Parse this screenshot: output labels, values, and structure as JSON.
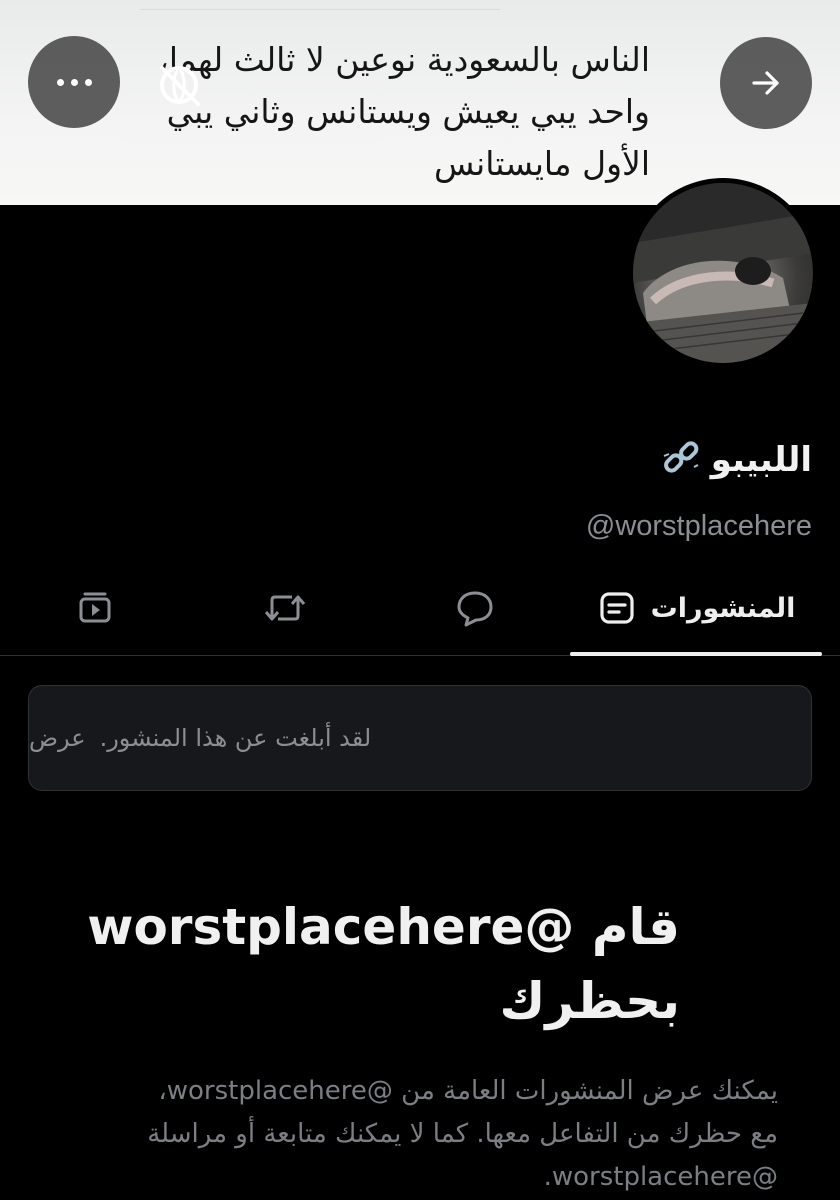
{
  "banner": {
    "text_lines": [
      "الناس بالسعودية نوعين لا ثالث لهما،",
      "واحد يبي يعيش ويستانس وثاني يبي",
      "الأول مايستانس"
    ],
    "more_icon": "more-horizontal-icon",
    "next_icon": "arrow-right-icon",
    "translate_icon": "no-translate-icon"
  },
  "profile": {
    "display_name": "اللبيبو",
    "name_emoji_icon": "broken-chain-icon",
    "handle": "@worstplacehere"
  },
  "tabs": [
    {
      "label": "المنشورات",
      "icon": "posts-icon",
      "active": true
    },
    {
      "label": "",
      "icon": "reply-bubble-icon",
      "active": false
    },
    {
      "label": "",
      "icon": "repost-icon",
      "active": false
    },
    {
      "label": "",
      "icon": "media-icon",
      "active": false
    }
  ],
  "notice": {
    "text": "لقد أبلغت عن هذا المنشور.",
    "action": "عرض"
  },
  "blocked": {
    "title_lines": [
      "قام @worstplacehere",
      "بحظرك"
    ],
    "description_lines": [
      "يمكنك عرض المنشورات العامة من @worstplacehere،",
      "مع حظرك من التفاعل معها. كما لا يمكنك متابعة أو مراسلة",
      "@worstplacehere."
    ]
  },
  "colors": {
    "background": "#000000",
    "text_primary": "#e7e9ea",
    "text_secondary": "#8b8f94",
    "card": "#16181c",
    "border": "#2f3336"
  }
}
